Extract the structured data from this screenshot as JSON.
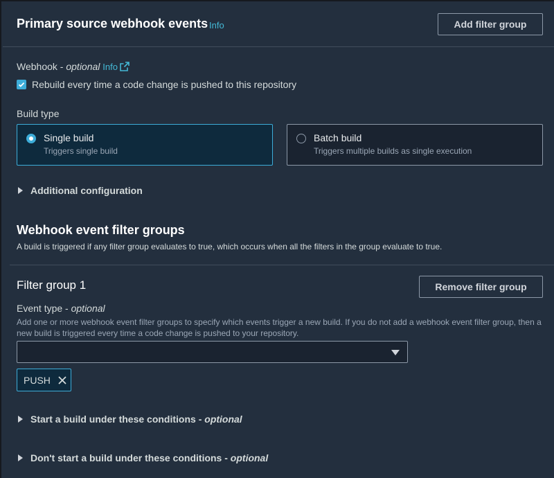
{
  "header": {
    "title": "Primary source webhook events",
    "info": "Info",
    "add_filter_group": "Add filter group"
  },
  "webhook": {
    "label": "Webhook",
    "separator": " - ",
    "optional": "optional",
    "info": "Info",
    "checkbox_label": "Rebuild every time a code change is pushed to this repository",
    "checked": true
  },
  "build_type": {
    "label": "Build type",
    "options": [
      {
        "title": "Single build",
        "desc": "Triggers single build",
        "selected": true
      },
      {
        "title": "Batch build",
        "desc": "Triggers multiple builds as single execution",
        "selected": false
      }
    ]
  },
  "additional_configuration": "Additional configuration",
  "filter_groups_section": {
    "title": "Webhook event filter groups",
    "description": "A build is triggered if any filter group evaluates to true, which occurs when all the filters in the group evaluate to true."
  },
  "filter_group": {
    "title": "Filter group 1",
    "remove_button": "Remove filter group",
    "event_type_label": "Event type",
    "event_type_separator": " - ",
    "event_type_optional": "optional",
    "event_type_help": "Add one or more webhook event filter groups to specify which events trigger a new build. If you do not add a webhook event filter group, then a new build is triggered every time a code change is pushed to your repository.",
    "select_value": "",
    "tokens": [
      "PUSH"
    ],
    "start_conditions": "Start a build under these conditions",
    "dont_start_conditions": "Don't start a build under these conditions",
    "conditions_separator": " - ",
    "optional": "optional"
  },
  "colors": {
    "background": "#232f3e",
    "accent": "#3dadd9",
    "info_link": "#44b9d6",
    "border": "#8d99a8"
  },
  "icons": [
    "external-link-icon",
    "checkmark-icon",
    "caret-right-icon",
    "dropdown-arrow-icon",
    "close-icon"
  ]
}
